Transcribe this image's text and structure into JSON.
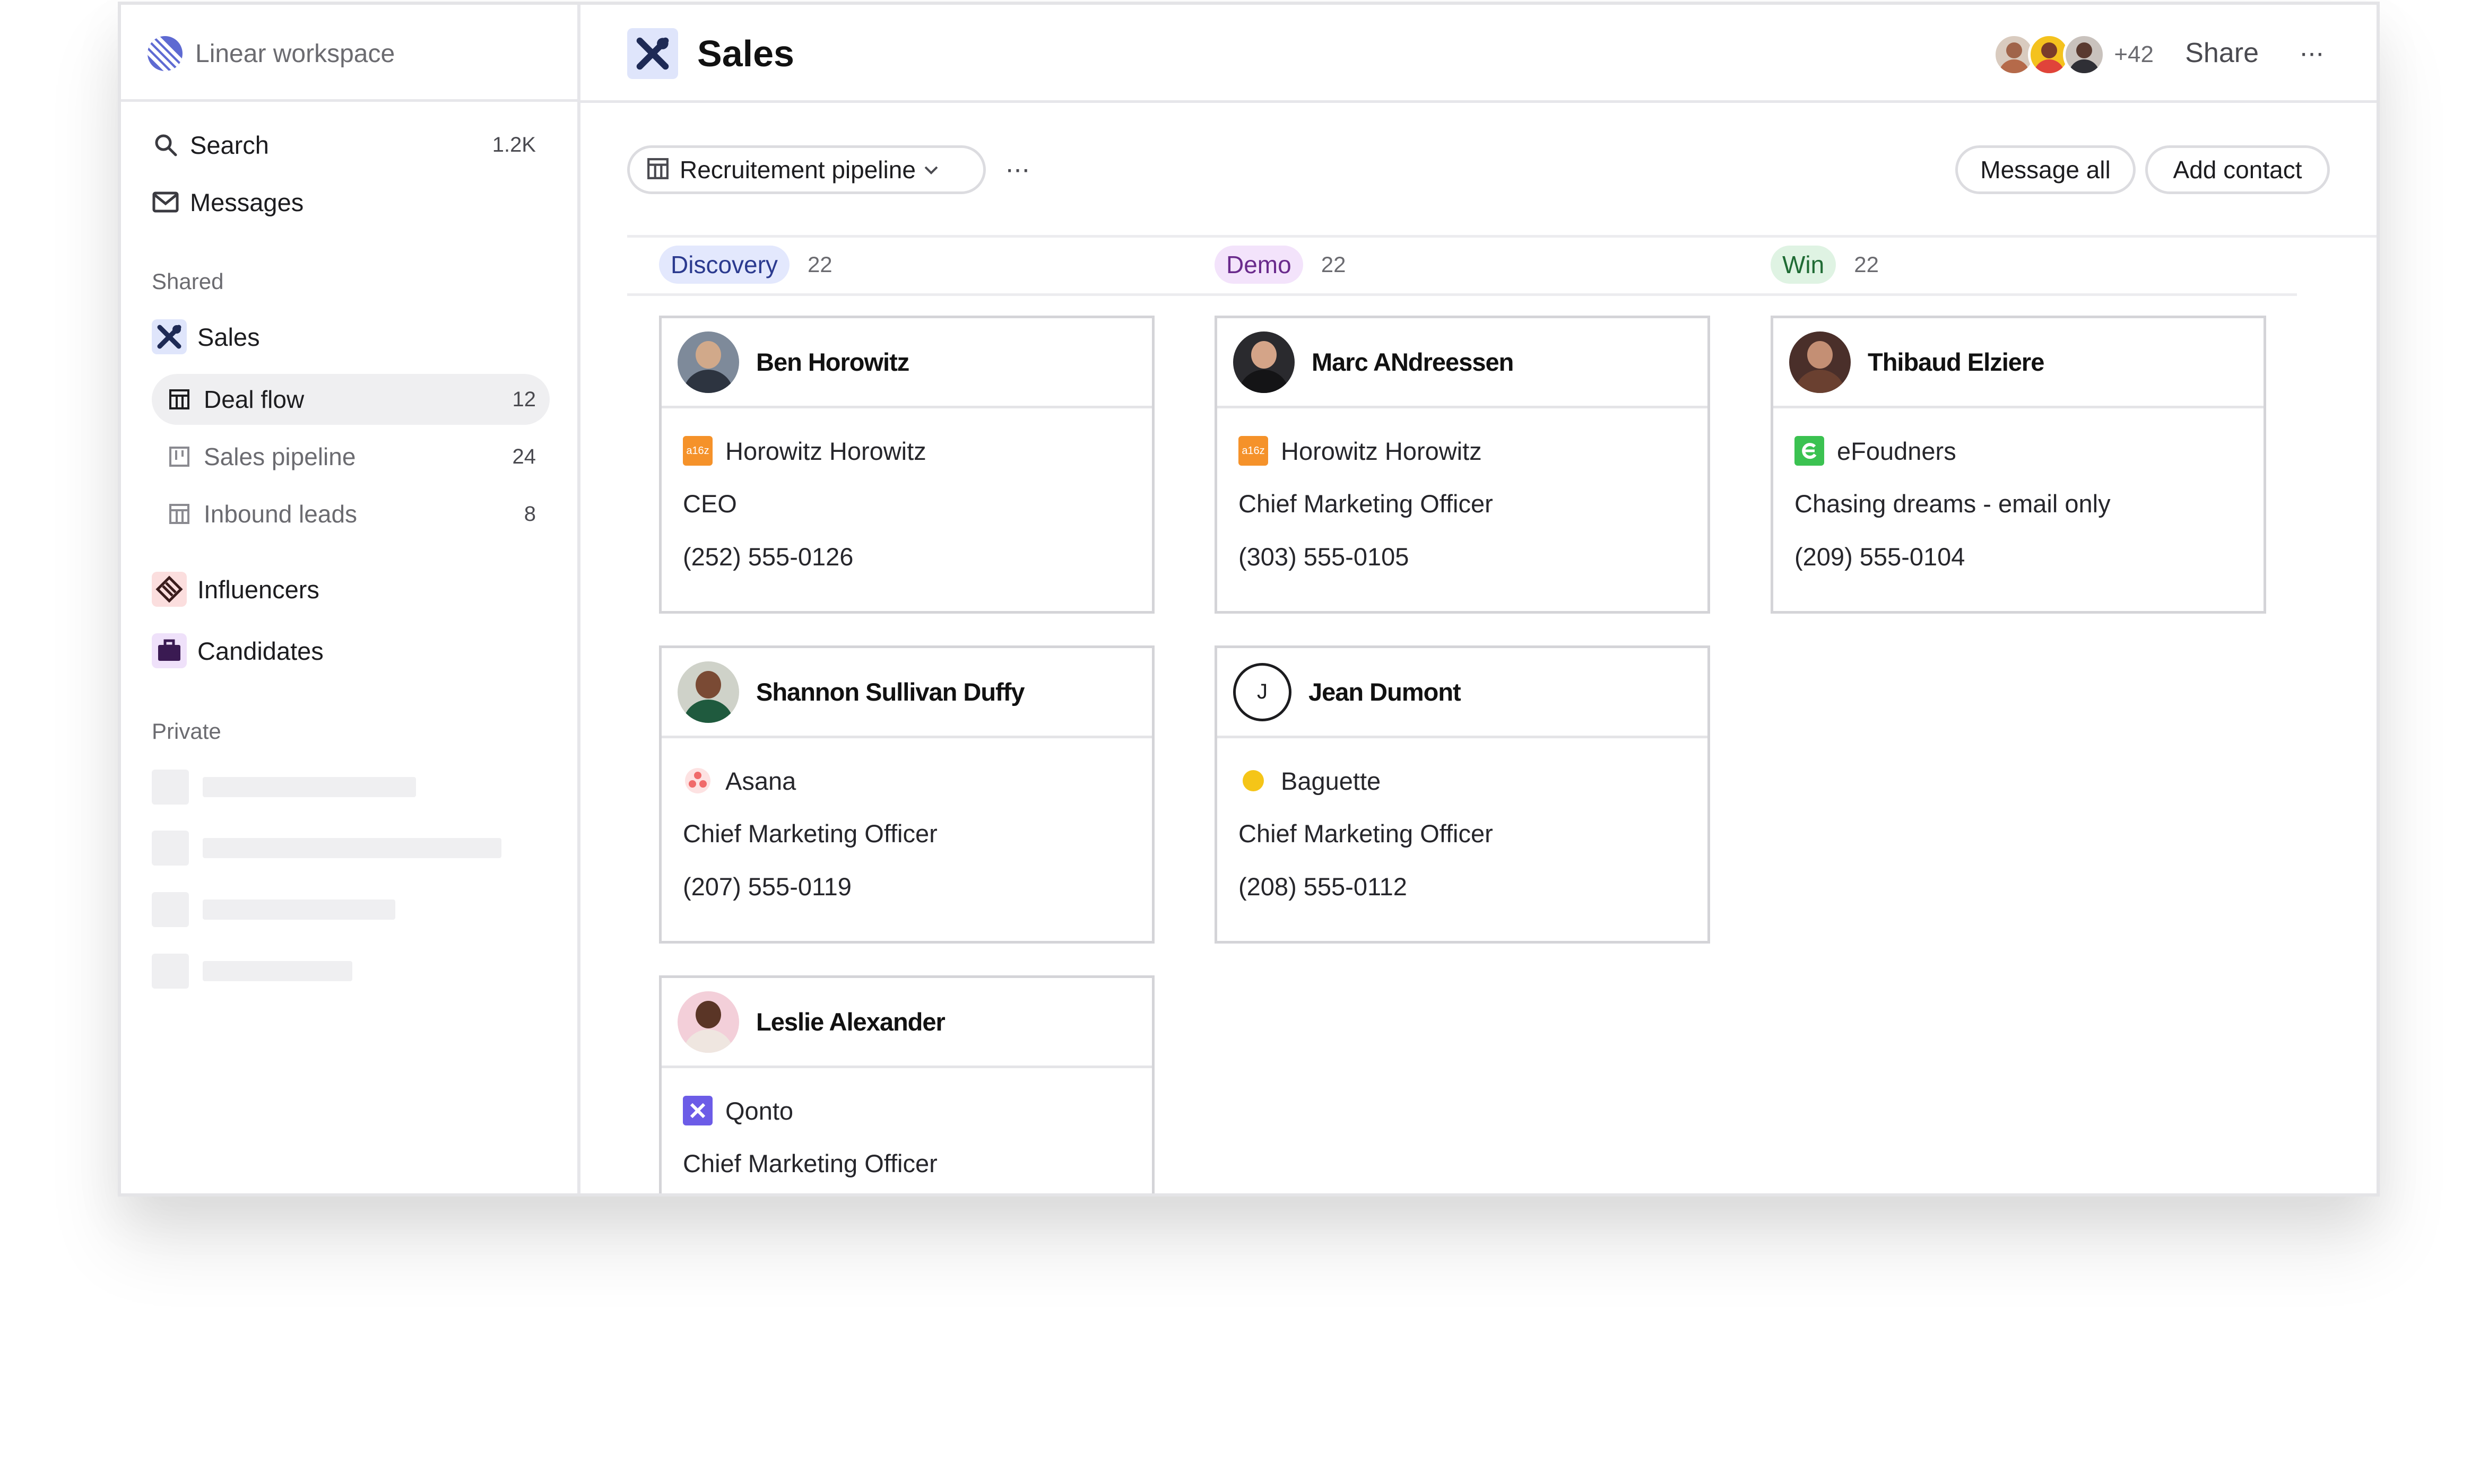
{
  "workspace": {
    "name": "Linear workspace"
  },
  "sidebar": {
    "search": {
      "label": "Search",
      "count": "1.2K"
    },
    "messages": {
      "label": "Messages"
    },
    "shared_label": "Shared",
    "sales": {
      "label": "Sales"
    },
    "sub_items": [
      {
        "label": "Deal flow",
        "count": "12"
      },
      {
        "label": "Sales pipeline",
        "count": "24"
      },
      {
        "label": "Inbound leads",
        "count": "8"
      }
    ],
    "influencers": {
      "label": "Influencers"
    },
    "candidates": {
      "label": "Candidates"
    },
    "private_label": "Private"
  },
  "header": {
    "title": "Sales",
    "members_more": "+42",
    "share_label": "Share",
    "more_label": "···"
  },
  "toolbar": {
    "view_label": "Recruitement pipeline",
    "more_label": "···",
    "message_all": "Message all",
    "add_contact": "Add contact"
  },
  "columns": [
    {
      "name": "Discovery",
      "count": "22",
      "tag_bg": "#e3e8fd",
      "tag_fg": "#2b3a8f",
      "cards": [
        {
          "name": "Ben Horowitz",
          "company": "Horowitz Horowitz",
          "company_icon": "a16z-icon",
          "role": "CEO",
          "phone": "(252) 555-0126"
        },
        {
          "name": "Shannon Sullivan Duffy",
          "company": "Asana",
          "company_icon": "asana-icon",
          "role": "Chief Marketing Officer",
          "phone": "(207) 555-0119"
        },
        {
          "name": "Leslie Alexander",
          "company": "Qonto",
          "company_icon": "qonto-icon",
          "role": "Chief Marketing Officer",
          "phone": ""
        }
      ]
    },
    {
      "name": "Demo",
      "count": "22",
      "tag_bg": "#f3e3fb",
      "tag_fg": "#6a2a8c",
      "cards": [
        {
          "name": "Marc ANdreessen",
          "company": "Horowitz Horowitz",
          "company_icon": "a16z-icon",
          "role": "Chief Marketing Officer",
          "phone": "(303) 555-0105"
        },
        {
          "name": "Jean Dumont",
          "initial": "J",
          "company": "Baguette",
          "company_icon": "baguette-icon",
          "role": "Chief Marketing Officer",
          "phone": "(208) 555-0112"
        }
      ]
    },
    {
      "name": "Win",
      "count": "22",
      "tag_bg": "#dff3e3",
      "tag_fg": "#1f6b34",
      "cards": [
        {
          "name": "Thibaud Elziere",
          "company": "eFoudners",
          "company_icon": "efounders-icon",
          "role": "Chasing dreams - email only",
          "phone": "(209) 555-0104"
        }
      ]
    }
  ],
  "colors": {
    "accent": "#5e6ad2",
    "a16z": "#f5922a",
    "asana": "#f06a6a",
    "qonto": "#6c5ce7",
    "efounders": "#3bc251",
    "baguette": "#f5c518"
  }
}
